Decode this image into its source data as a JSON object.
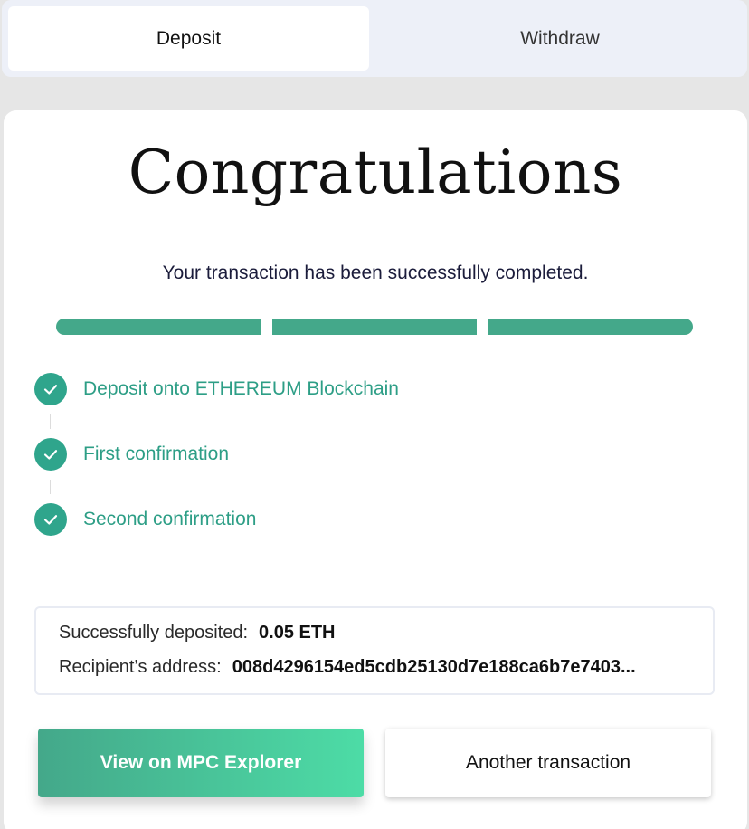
{
  "tabs": {
    "deposit": "Deposit",
    "withdraw": "Withdraw"
  },
  "card": {
    "title": "Congratulations",
    "subtitle": "Your transaction has been successfully completed.",
    "progress_completed_segments": 3,
    "progress_total_segments": 3
  },
  "steps": [
    {
      "label": "Deposit onto ETHEREUM Blockchain",
      "icon": "check-icon",
      "done": true
    },
    {
      "label": "First confirmation",
      "icon": "check-icon",
      "done": true
    },
    {
      "label": "Second confirmation",
      "icon": "check-icon",
      "done": true
    }
  ],
  "info": {
    "deposited_label": "Successfully deposited:",
    "deposited_value": "0.05 ETH",
    "address_label": "Recipient’s address:",
    "address_value": "008d4296154ed5cdb25130d7e188ca6b7e7403..."
  },
  "buttons": {
    "explorer": "View on MPC Explorer",
    "another": "Another transaction"
  },
  "colors": {
    "accent": "#44a88a",
    "accent_light": "#4ddca6",
    "step_text": "#2d9e86",
    "check_bg": "#2fa58c"
  }
}
